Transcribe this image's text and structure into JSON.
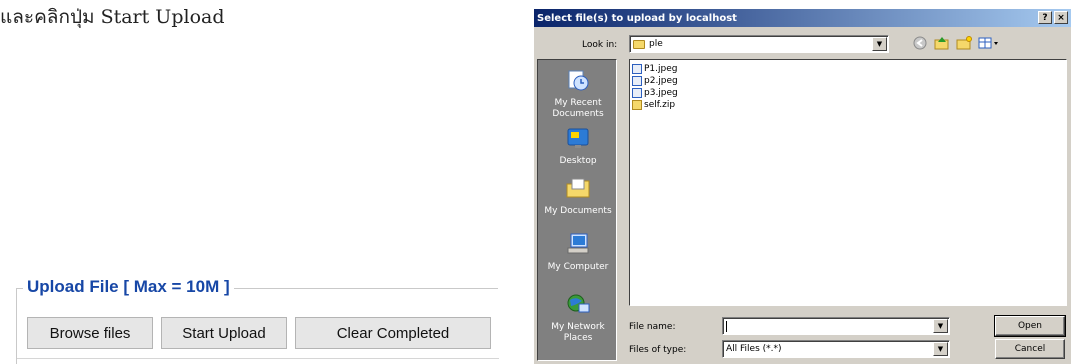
{
  "instruction": "และคลิกปุ่ม Start Upload",
  "upload": {
    "legend": "Upload File [ Max = 10M ]",
    "buttons": {
      "browse": "Browse files",
      "start": "Start Upload",
      "clear": "Clear Completed"
    }
  },
  "dialog": {
    "title": "Select file(s) to upload by localhost",
    "titlebar_buttons": {
      "help": "?",
      "close": "×"
    },
    "look_in_label": "Look in:",
    "look_in_value": "ple",
    "places": [
      {
        "label": "My Recent Documents",
        "icon": "recent-documents-icon"
      },
      {
        "label": "Desktop",
        "icon": "desktop-icon"
      },
      {
        "label": "My Documents",
        "icon": "my-documents-icon"
      },
      {
        "label": "My Computer",
        "icon": "my-computer-icon"
      },
      {
        "label": "My Network Places",
        "icon": "network-places-icon"
      }
    ],
    "files": [
      {
        "name": "P1.jpeg",
        "type": "image"
      },
      {
        "name": "p2.jpeg",
        "type": "image"
      },
      {
        "name": "p3.jpeg",
        "type": "image"
      },
      {
        "name": "self.zip",
        "type": "zip"
      }
    ],
    "file_name_label": "File name:",
    "file_name_value": "",
    "files_of_type_label": "Files of type:",
    "files_of_type_value": "All Files (*.*)",
    "open_label": "Open",
    "cancel_label": "Cancel"
  }
}
